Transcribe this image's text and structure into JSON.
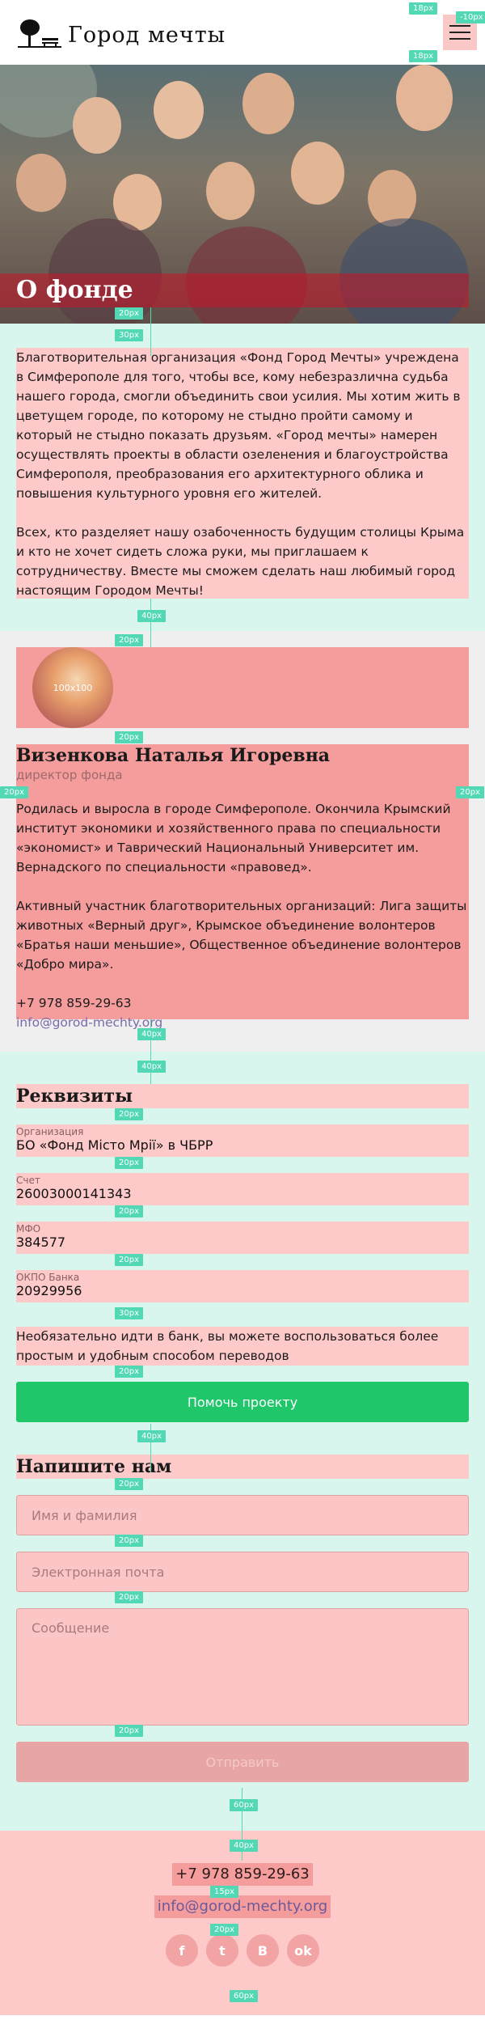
{
  "header": {
    "logo_text": "Город мечты",
    "menu_label": "≡"
  },
  "hero": {
    "title": "О фонде"
  },
  "about": {
    "paragraph1": "Благотворительная организация «Фонд Город Мечты» учреждена в Симферополе для того, чтобы все, кому небезразлична судьба нашего города, смогли объединить свои усилия. Мы хотим жить в цветущем городе, по которому не стыдно пройти самому и который не стыдно показать друзьям. «Город мечты» намерен осуществлять проекты в области озеленения и благоустройства Симферополя, преобразования его архитектурного облика и повышения культурного уровня его жителей.",
    "paragraph2": "Всех, кто разделяет нашу озабоченность будущим столицы Крыма и кто не хочет сидеть сложа руки, мы приглашаем к сотрудничеству. Вместе мы сможем сделать наш любимый город настоящим Городом Мечты!"
  },
  "director": {
    "avatar_label": "100x100",
    "name": "Визенкова Наталья Игоревна",
    "position": "директор фонда",
    "bio1": "Родилась и выросла в городе Симферополе. Окончила Крымский институт экономики и хозяйственного права по специальности «экономист» и Таврический Национальный Университет им. Вернадского по специальности «правовед».",
    "bio2": "Активный участник благотворительных организаций: Лига защиты животных «Верный друг», Крымское объединение волонтеров «Братья наши меньшие», Общественное объединение волонтеров «Добро мира».",
    "phone": "+7 978 859-29-63",
    "email": "info@gorod-mechty.org"
  },
  "requisites": {
    "title": "Реквизиты",
    "fields": [
      {
        "label": "Организация",
        "value": "БО «Фонд Місто Мрії» в ЧБРР"
      },
      {
        "label": "Счет",
        "value": "26003000141343"
      },
      {
        "label": "МФО",
        "value": "384577"
      },
      {
        "label": "ОКПО Банка",
        "value": "20929956"
      }
    ],
    "note": "Необязательно идти в банк, вы можете воспользоваться более простым и удобным способом переводов",
    "help_button": "Помочь проекту"
  },
  "contact_form": {
    "title": "Напишите нам",
    "name_placeholder": "Имя и фамилия",
    "email_placeholder": "Электронная почта",
    "message_placeholder": "Сообщение",
    "submit_label": "Отправить"
  },
  "footer": {
    "phone": "+7 978 859-29-63",
    "email": "info@gorod-mechty.org",
    "social": [
      {
        "name": "facebook-icon",
        "glyph": "f"
      },
      {
        "name": "twitter-icon",
        "glyph": "t"
      },
      {
        "name": "vk-icon",
        "glyph": "B"
      },
      {
        "name": "odnoklassniki-icon",
        "glyph": "ok"
      }
    ]
  },
  "spacing_tags": {
    "t18a": "18px",
    "t10": "-10px",
    "t18b": "18px",
    "t20": "20px",
    "t30": "30px",
    "t40": "40px",
    "t15": "15px",
    "t60": "60px"
  },
  "colors": {
    "accent_green": "#1fc76a",
    "overlay_pink": "#fdc9c9",
    "overlay_mint": "#d8f6ee",
    "spacing_tag": "#52d8b4"
  }
}
